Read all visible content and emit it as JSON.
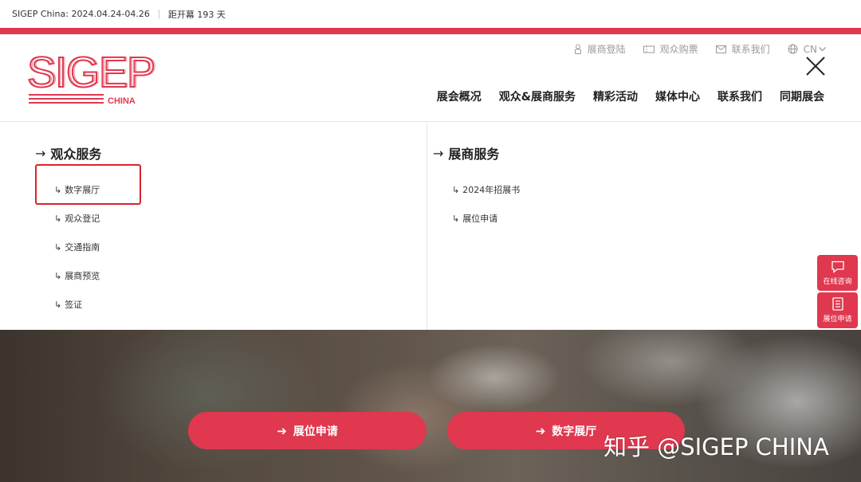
{
  "topbar": {
    "event_dates": "SIGEP China: 2024.04.24-04.26",
    "countdown": "距开幕 193 天"
  },
  "logo": {
    "main": "SIGEP",
    "sub": "CHINA"
  },
  "utility": {
    "exhibitor_login": "展商登陆",
    "buy_ticket": "观众购票",
    "contact": "联系我们",
    "lang": "CN"
  },
  "mainnav": {
    "items": [
      "展会概况",
      "观众&展商服务",
      "精彩活动",
      "媒体中心",
      "联系我们",
      "同期展会"
    ]
  },
  "panel": {
    "left": {
      "title": "观众服务",
      "items": [
        "数字展厅",
        "观众登记",
        "交通指南",
        "展商预览",
        "签证"
      ]
    },
    "right": {
      "title": "展商服务",
      "items": [
        "2024年招展书",
        "展位申请"
      ]
    }
  },
  "side": {
    "consult": "在线咨询",
    "booth": "展位申请"
  },
  "hero": {
    "btn_booth": "展位申请",
    "btn_digital": "数字展厅",
    "watermark": "知乎 @SIGEP CHINA"
  },
  "colors": {
    "accent": "#e0384f",
    "highlight_box": "#d9252b"
  }
}
